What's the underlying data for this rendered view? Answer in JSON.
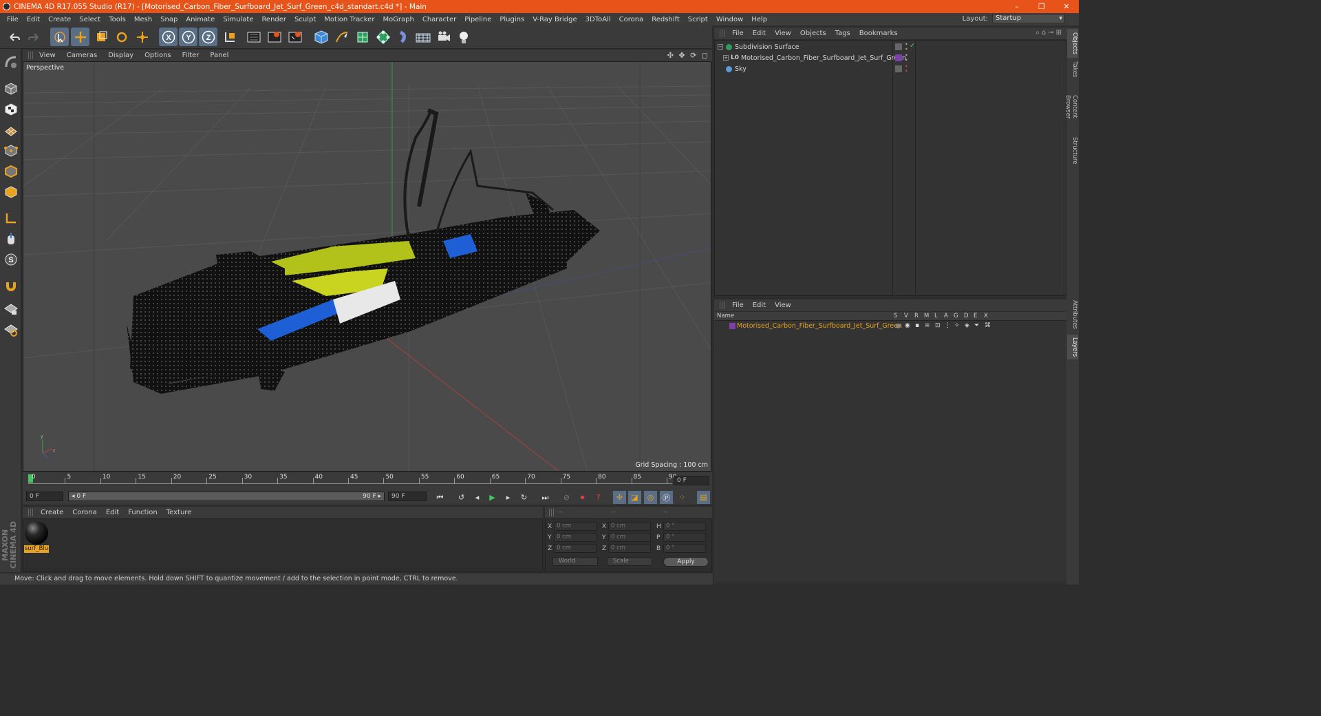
{
  "window": {
    "title": "CINEMA 4D R17.055 Studio (R17) - [Motorised_Carbon_Fiber_Surfboard_Jet_Surf_Green_c4d_standart.c4d *] - Main",
    "controls": [
      "–",
      "❐",
      "✕"
    ]
  },
  "menubar": {
    "items": [
      "File",
      "Edit",
      "Create",
      "Select",
      "Tools",
      "Mesh",
      "Snap",
      "Animate",
      "Simulate",
      "Render",
      "Sculpt",
      "Motion Tracker",
      "MoGraph",
      "Character",
      "Pipeline",
      "Plugins",
      "V-Ray Bridge",
      "3DToAll",
      "Corona",
      "Redshift",
      "Script",
      "Window",
      "Help"
    ],
    "layout_label": "Layout:",
    "layout_value": "Startup"
  },
  "toolbar": {
    "axis_x": "X",
    "axis_y": "Y",
    "axis_z": "Z"
  },
  "viewport": {
    "menu": [
      "View",
      "Cameras",
      "Display",
      "Options",
      "Filter",
      "Panel"
    ],
    "camera_label": "Perspective",
    "grid_spacing": "Grid Spacing : 100 cm",
    "nav_icons": "✣ ✥ ⟳ ◻"
  },
  "timeline": {
    "ticks": [
      "0",
      "5",
      "10",
      "15",
      "20",
      "25",
      "30",
      "35",
      "40",
      "45",
      "50",
      "55",
      "60",
      "65",
      "70",
      "75",
      "80",
      "85",
      "90"
    ],
    "current_frame_field": "0 F",
    "start_field": "0 F",
    "range_start": "◂ 0 F",
    "range_end": "90 F ▸",
    "end_field": "90 F"
  },
  "material_manager": {
    "menu": [
      "Create",
      "Corona",
      "Edit",
      "Function",
      "Texture"
    ],
    "materials": [
      {
        "name": "surf_Blu"
      }
    ]
  },
  "coordinates": {
    "headers": [
      "--",
      "--",
      "--"
    ],
    "rows": [
      {
        "a": "X",
        "av": "0 cm",
        "b": "X",
        "bv": "0 cm",
        "c": "H",
        "cv": "0 °"
      },
      {
        "a": "Y",
        "av": "0 cm",
        "b": "Y",
        "bv": "0 cm",
        "c": "P",
        "cv": "0 °"
      },
      {
        "a": "Z",
        "av": "0 cm",
        "b": "Z",
        "bv": "0 cm",
        "c": "B",
        "cv": "0 °"
      }
    ],
    "mode1": "World",
    "mode2": "Scale",
    "apply": "Apply"
  },
  "statusbar": {
    "text": "Move: Click and drag to move elements. Hold down SHIFT to quantize movement / add to the selection in point mode, CTRL to remove."
  },
  "object_manager": {
    "menu": [
      "File",
      "Edit",
      "View",
      "Objects",
      "Tags",
      "Bookmarks"
    ],
    "objects": [
      {
        "name": "Subdivision Surface"
      },
      {
        "name": "Motorised_Carbon_Fiber_Surfboard_Jet_Surf_Green"
      },
      {
        "name": "Sky"
      }
    ]
  },
  "layer_manager": {
    "menu": [
      "File",
      "Edit",
      "View"
    ],
    "columns": [
      "Name",
      "S",
      "V",
      "R",
      "M",
      "L",
      "A",
      "G",
      "D",
      "E",
      "X"
    ],
    "layers": [
      {
        "name": "Motorised_Carbon_Fiber_Surfboard_Jet_Surf_Green",
        "color": "#7a3fa8"
      }
    ]
  },
  "right_tabs": [
    "Objects",
    "Takes",
    "Content Browser",
    "Structure",
    "Attributes",
    "Layers"
  ],
  "brand": {
    "maxon": "MAXON CINEMA 4D"
  },
  "colors": {
    "title_bar": "#e8531a",
    "accent_active": "#5a6e85",
    "selection_orange": "#e8a21e"
  }
}
